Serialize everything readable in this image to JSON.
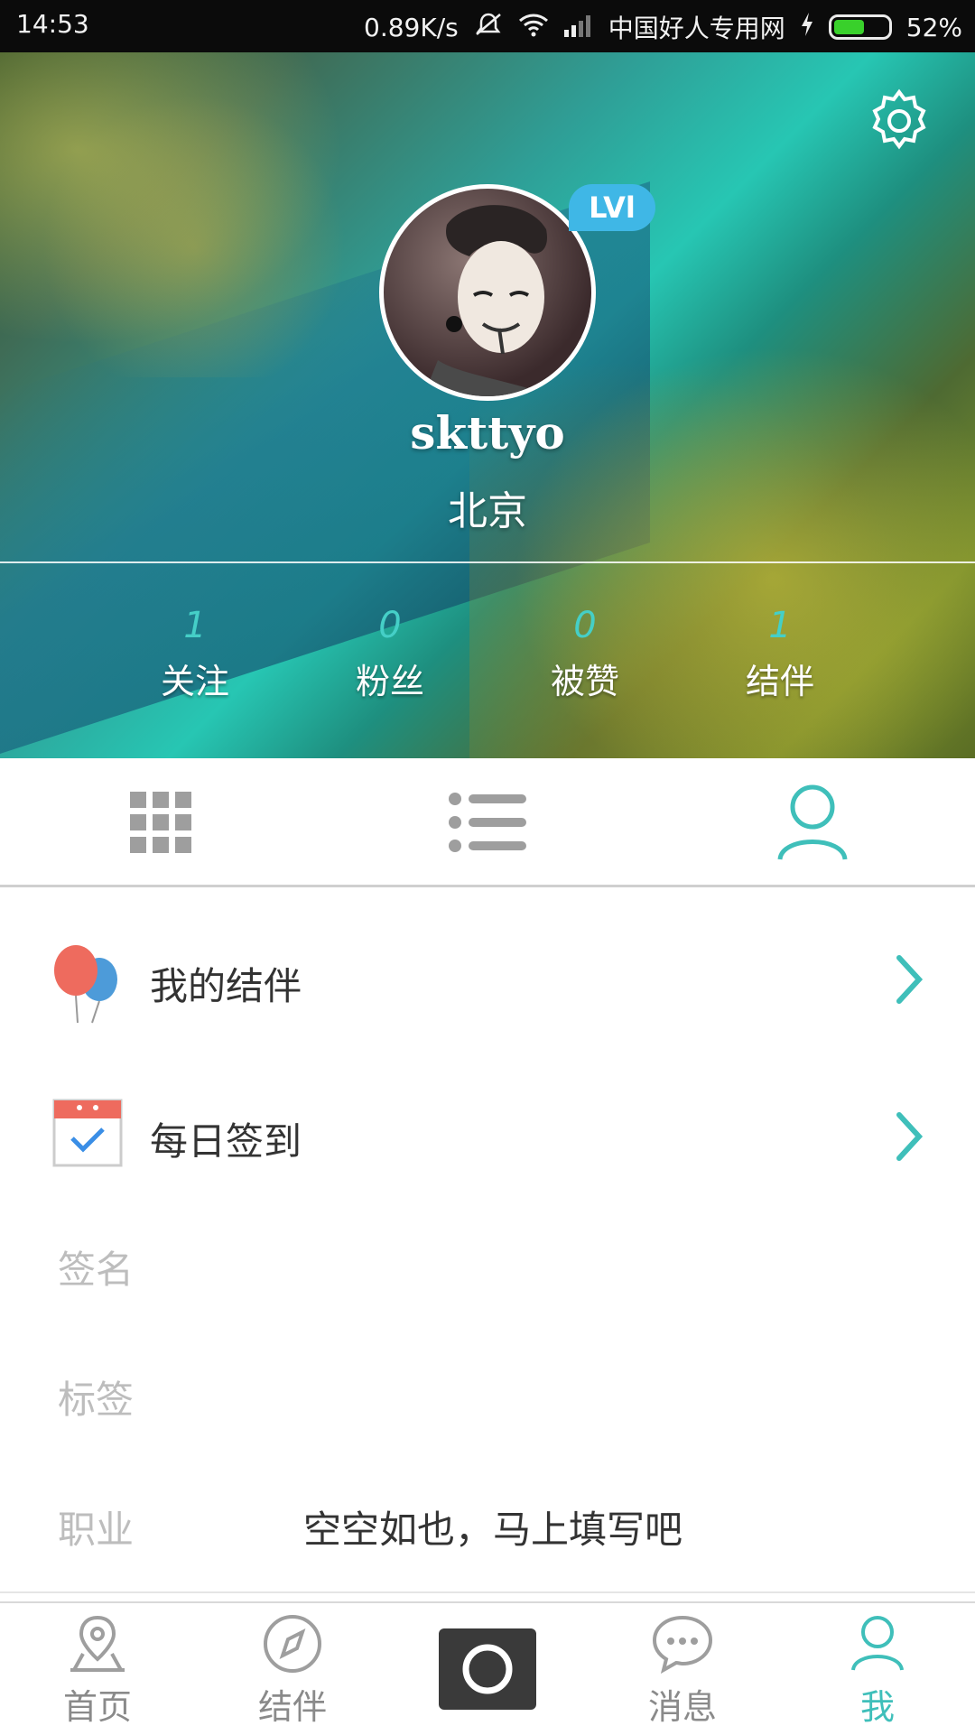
{
  "status_bar": {
    "time": "14:53",
    "speed": "0.89K/s",
    "carrier": "中国好人专用网",
    "battery": "52%",
    "battery_level": 0.52
  },
  "profile": {
    "level": "LVl",
    "username": "skttyo",
    "location": "北京"
  },
  "stats": [
    {
      "value": "1",
      "label": "关注"
    },
    {
      "value": "0",
      "label": "粉丝"
    },
    {
      "value": "0",
      "label": "被赞"
    },
    {
      "value": "1",
      "label": "结伴"
    }
  ],
  "tabs": {
    "active": "profile",
    "items": [
      "grid-view",
      "list-view",
      "profile"
    ]
  },
  "menu": {
    "my_companions": "我的结伴",
    "daily_checkin": "每日签到"
  },
  "fields": {
    "signature_label": "签名",
    "tags_label": "标签",
    "job_label": "职业",
    "job_value": "空空如也，马上填写吧"
  },
  "bottom_nav": {
    "home": "首页",
    "companions": "结伴",
    "messages": "消息",
    "me": "我"
  },
  "colors": {
    "accent": "#3fbfba",
    "badge": "#3fb7e6",
    "stat_number": "#45cfc7",
    "inactive_icon": "#9e9e9e"
  }
}
